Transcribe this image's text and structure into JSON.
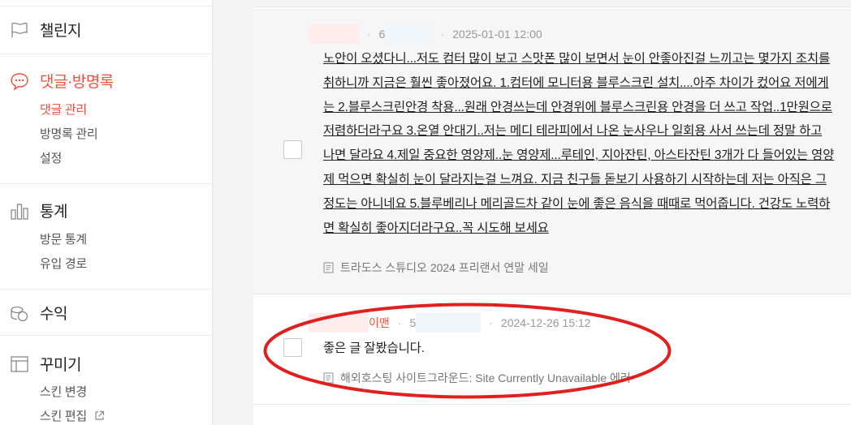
{
  "sidebar": {
    "challenge": {
      "label": "챌린지",
      "icon": "flag-icon"
    },
    "comments": {
      "label": "댓글·방명록",
      "icon": "speech-bubble-icon",
      "items": [
        "댓글 관리",
        "방명록 관리",
        "설정"
      ]
    },
    "stats": {
      "label": "통계",
      "icon": "bar-chart-icon",
      "items": [
        "방문 통계",
        "유입 경로"
      ]
    },
    "revenue": {
      "label": "수익",
      "icon": "coins-icon"
    },
    "decorate": {
      "label": "꾸미기",
      "icon": "layout-icon",
      "items": [
        "스킨 변경",
        "스킨 편집"
      ]
    }
  },
  "comments": [
    {
      "id_prefix": "6",
      "date": "2025-01-01 12:00",
      "text": "노안이 오셨다니...저도 컴터 많이 보고 스맛폰 많이 보면서 눈이 안좋아진걸 느끼고는 몇가지 조치를 취하니까 지금은 훨씬 좋아졌어요. 1.컴터에 모니터용 블루스크린 설치....아주 차이가 컸어요 저에게는 2.블루스크린안경 착용...원래 안경쓰는데 안경위에 블루스크린용 안경을 더 쓰고 작업..1만원으로 저렴하더라구요 3.온열 안대기..저는 메디 테라피에서 나온 눈사우나 일회용 사서 쓰는데 정말 하고 나면 달라요 4.제일 중요한 영양제..눈 영양제...루테인, 지아잔틴, 아스타잔틴 3개가 다 들어있는 영양제 먹으면 확실히 눈이 달라지는걸 느껴요. 지금 친구들 돋보기 사용하기 시작하는데 저는 아직은 그정도는 아니네요 5.블루베리나 메리골드차 같이 눈에 좋은 음식을 때때로 먹어줍니다. 건강도 노력하면 확실히 좋아지더라구요..꼭 시도해 보세요",
      "post": "트라도스 스튜디오 2024 프리랜서 연말 세일"
    },
    {
      "name_suffix": "이맨",
      "id_prefix": "5",
      "date": "2024-12-26 15:12",
      "text": "좋은 글 잘봤습니다.",
      "post": "해외호스팅 사이트그라운드: Site Currently Unavailable 에러"
    }
  ],
  "colors": {
    "accent": "#f0503c",
    "annotation": "#e0201e"
  }
}
